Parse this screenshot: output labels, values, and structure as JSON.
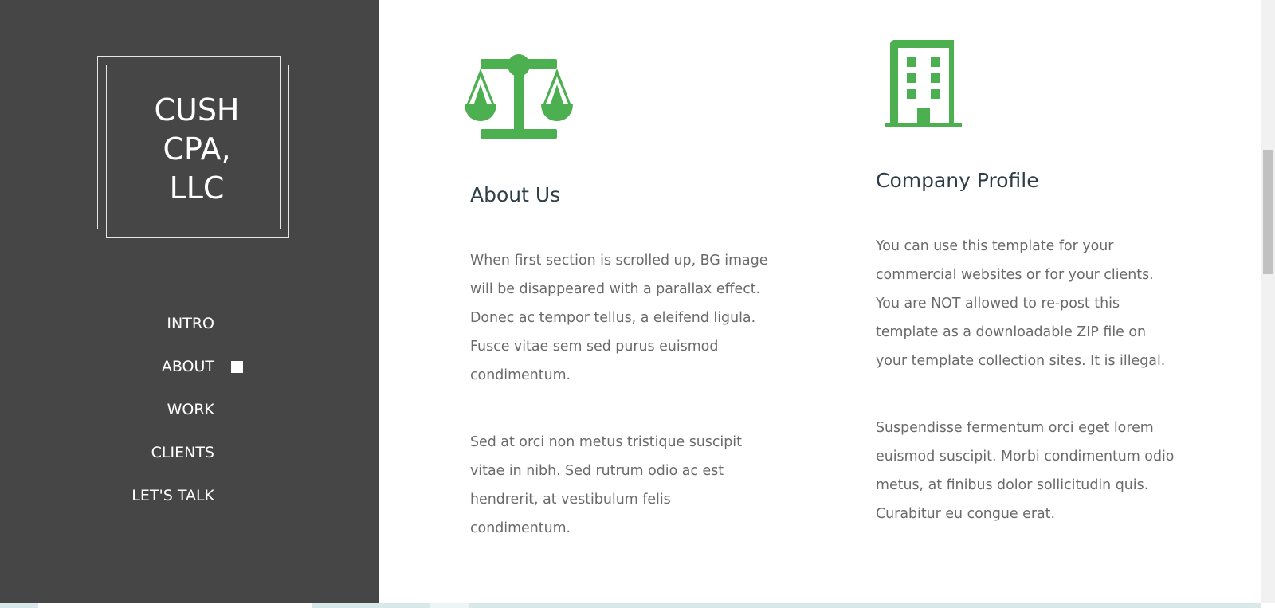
{
  "brand": {
    "logo_text": "CUSH\nCPA,\nLLC"
  },
  "nav": {
    "items": [
      {
        "label": "INTRO"
      },
      {
        "label": "ABOUT"
      },
      {
        "label": "WORK"
      },
      {
        "label": "CLIENTS"
      },
      {
        "label": "LET'S TALK"
      }
    ],
    "active": "ABOUT"
  },
  "about": {
    "icon": "balance-scale-icon",
    "title": "About Us",
    "paragraphs": [
      "When first section is scrolled up, BG image will be disappeared with a parallax effect. Donec ac tempor tellus, a eleifend ligula. Fusce vitae sem sed purus euismod condimentum.",
      "Sed at orci non metus tristique suscipit vitae in nibh. Sed rutrum odio ac est hendrerit, at vestibulum felis condimentum."
    ]
  },
  "profile": {
    "icon": "building-icon",
    "title": "Company Profile",
    "paragraphs": [
      "You can use this template for your commercial websites or for your clients. You are NOT allowed to re-post this template as a downloadable ZIP file on your template collection sites. It is illegal.",
      "Suspendisse fermentum orci eget lorem euismod suscipit. Morbi condimentum odio metus, at finibus dolor sollicitudin quis. Curabitur eu congue erat."
    ]
  },
  "colors": {
    "sidebar_bg": "#464646",
    "accent_green": "#4caf50",
    "heading": "#2f3d45",
    "body_text": "#6a6a6a"
  }
}
